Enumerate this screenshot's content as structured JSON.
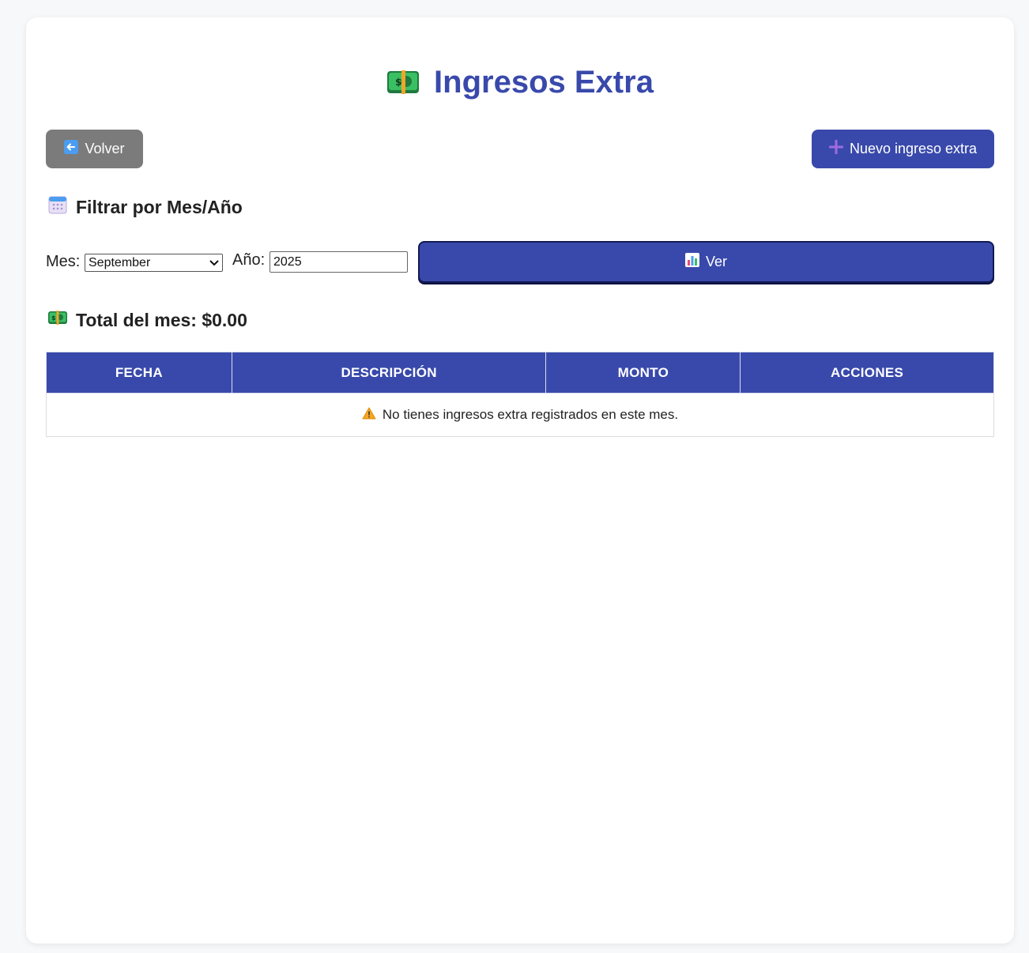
{
  "header": {
    "title": "Ingresos Extra",
    "title_icon": "money-banknote-icon"
  },
  "actions": {
    "back_label": "Volver",
    "back_icon": "arrow-left-icon",
    "new_label": "Nuevo ingreso extra",
    "new_icon": "plus-icon"
  },
  "filter": {
    "heading": "Filtrar por Mes/Año",
    "heading_icon": "calendar-icon",
    "month_label": "Mes:",
    "month_value": "September",
    "year_label": "Año:",
    "year_value": "2025",
    "submit_label": "Ver",
    "submit_icon": "bar-chart-icon"
  },
  "total": {
    "label": "Total del mes: $0.00",
    "icon": "money-banknote-icon"
  },
  "table": {
    "columns": [
      "FECHA",
      "DESCRIPCIÓN",
      "MONTO",
      "ACCIONES"
    ],
    "empty_message": "No tienes ingresos extra registrados en este mes.",
    "empty_icon": "warning-icon"
  },
  "colors": {
    "accent": "#3949ab",
    "secondary_button": "#7b7b7b",
    "background": "#f7f8fa"
  }
}
